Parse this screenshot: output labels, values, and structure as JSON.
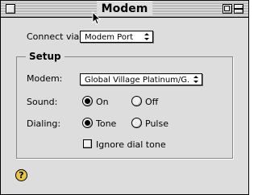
{
  "window": {
    "title": "Modem"
  },
  "connect": {
    "label": "Connect via:",
    "value": "Modem Port"
  },
  "setup": {
    "title": "Setup",
    "modem": {
      "label": "Modem:",
      "value": "Global Village Platinum/G..."
    },
    "sound": {
      "label": "Sound:",
      "options": [
        "On",
        "Off"
      ],
      "selected": "On"
    },
    "dialing": {
      "label": "Dialing:",
      "options": [
        "Tone",
        "Pulse"
      ],
      "selected": "Tone"
    },
    "ignore_dial_tone": {
      "label": "Ignore dial tone",
      "checked": false
    }
  },
  "icons": {
    "help": "help-icon",
    "cursor": "arrow-cursor-icon"
  },
  "colors": {
    "window_bg": "#dddddd",
    "help_icon": "#e8c640"
  }
}
